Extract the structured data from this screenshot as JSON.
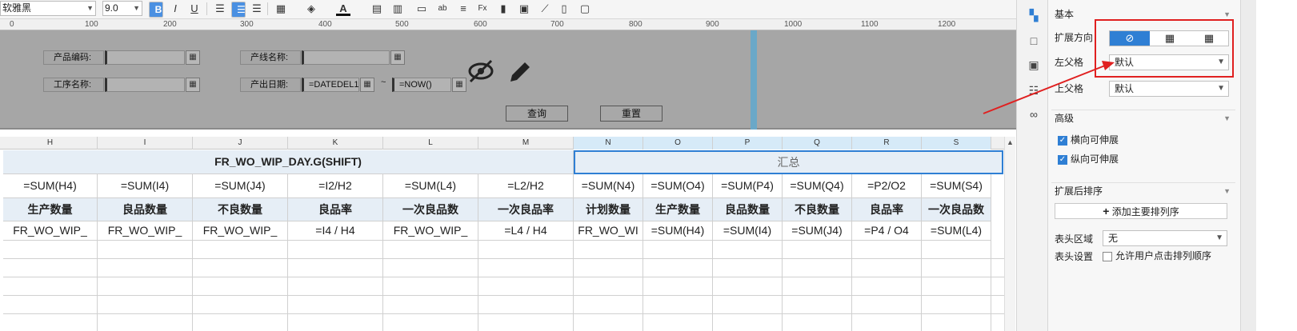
{
  "toolbar": {
    "font_name": "软雅黑",
    "font_size": "9.0",
    "bold": "B",
    "italic": "I",
    "underline": "U",
    "text_color_label": "A"
  },
  "ruler": {
    "ticks": [
      "0",
      "100",
      "200",
      "300",
      "400",
      "500",
      "600",
      "700",
      "800",
      "900",
      "1000",
      "1100",
      "1200"
    ]
  },
  "params": {
    "product_code_label": "产品编码:",
    "process_name_label": "工序名称:",
    "line_name_label": "产线名称:",
    "output_date_label": "产出日期:",
    "date_start_value": "=DATEDEL1",
    "date_tilde": "~",
    "date_end_value": "=NOW()",
    "query_button": "查询",
    "reset_button": "重置"
  },
  "sheet": {
    "columns": [
      "H",
      "I",
      "J",
      "K",
      "L",
      "M",
      "N",
      "O",
      "P",
      "Q",
      "R",
      "S"
    ],
    "title_left": "FR_WO_WIP_DAY.G(SHIFT)",
    "title_right": "汇总",
    "formula_row": [
      "=SUM(H4)",
      "=SUM(I4)",
      "=SUM(J4)",
      "=I2/H2",
      "=SUM(L4)",
      "=L2/H2",
      "=SUM(N4)",
      "=SUM(O4)",
      "=SUM(P4)",
      "=SUM(Q4)",
      "=P2/O2",
      "=SUM(S4)"
    ],
    "header_row": [
      "生产数量",
      "良品数量",
      "不良数量",
      "良品率",
      "一次良品数",
      "一次良品率",
      "计划数量",
      "生产数量",
      "良品数量",
      "不良数量",
      "良品率",
      "一次良品数"
    ],
    "data_row": [
      "FR_WO_WIP_",
      "FR_WO_WIP_",
      "FR_WO_WIP_",
      "=I4 / H4",
      "FR_WO_WIP_",
      "=L4 / H4",
      "FR_WO_WI",
      "=SUM(H4)",
      "=SUM(I4)",
      "=SUM(J4)",
      "=P4 / O4",
      "=SUM(L4)"
    ]
  },
  "properties": {
    "basic_section": "基本",
    "expand_direction_label": "扩展方向",
    "left_parent_label": "左父格",
    "left_parent_value": "默认",
    "top_parent_label": "上父格",
    "top_parent_value": "默认",
    "advanced_section": "高级",
    "horizontal_expand": "横向可伸展",
    "vertical_expand": "纵向可伸展",
    "sort_section": "扩展后排序",
    "add_sort_button": "添加主要排列序",
    "header_area_label": "表头区域",
    "header_area_value": "无",
    "header_settings_label": "表头设置",
    "allow_sort_label": "允许用户点击排列顺序"
  },
  "colors": {
    "accent": "#2f7fd4",
    "highlight_box": "#e02020",
    "selected_header": "#d6eaf8",
    "title_band": "#e6eef6"
  }
}
